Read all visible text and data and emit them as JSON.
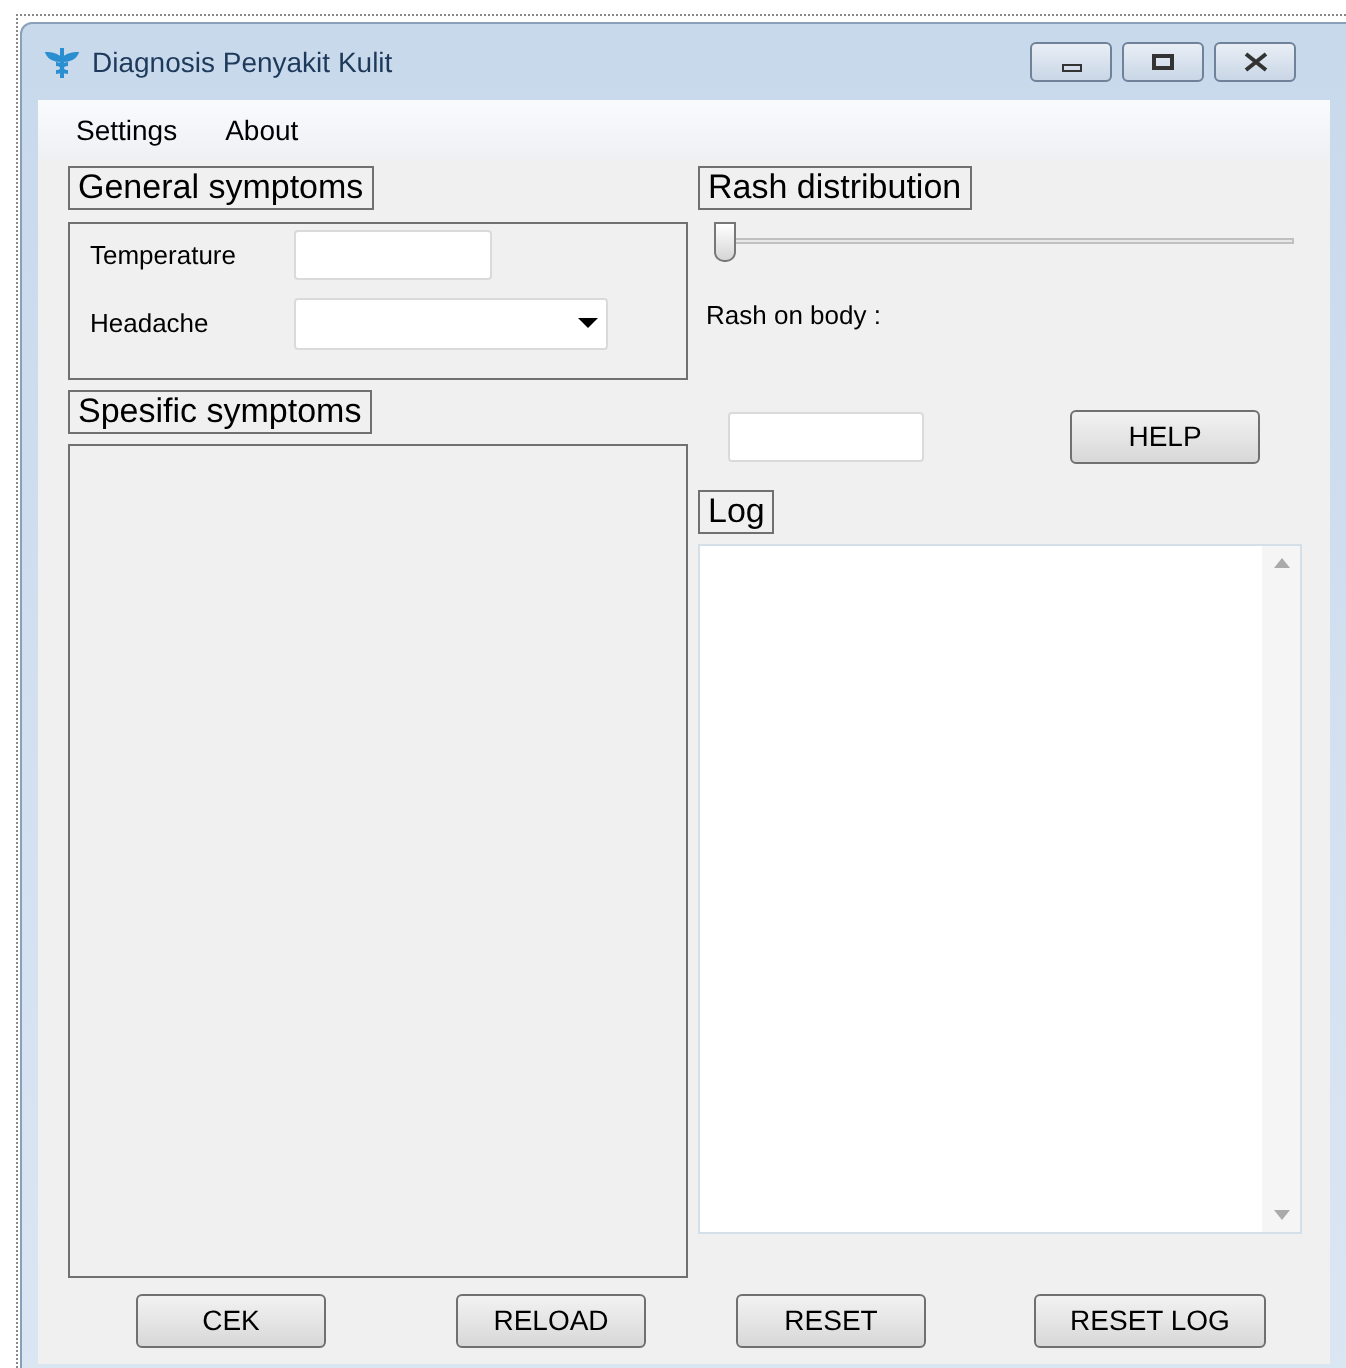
{
  "window": {
    "title": "Diagnosis Penyakit Kulit"
  },
  "menu": [
    "Settings",
    "About"
  ],
  "general_symptoms": {
    "title": "General symptoms",
    "fields": [
      {
        "kind": "text",
        "label": "Temperature"
      },
      {
        "kind": "dropdown",
        "label": "Headache"
      }
    ]
  },
  "specific_symptoms": {
    "title": "Spesific symptoms"
  },
  "rash_distribution": {
    "title": "Rash distribution",
    "slider": {
      "level": 0
    },
    "label": "Rash on body :",
    "help_button": "HELP"
  },
  "log": {
    "title": "Log"
  },
  "buttons": [
    "CEK",
    "RELOAD",
    "RESET",
    "RESET LOG"
  ]
}
